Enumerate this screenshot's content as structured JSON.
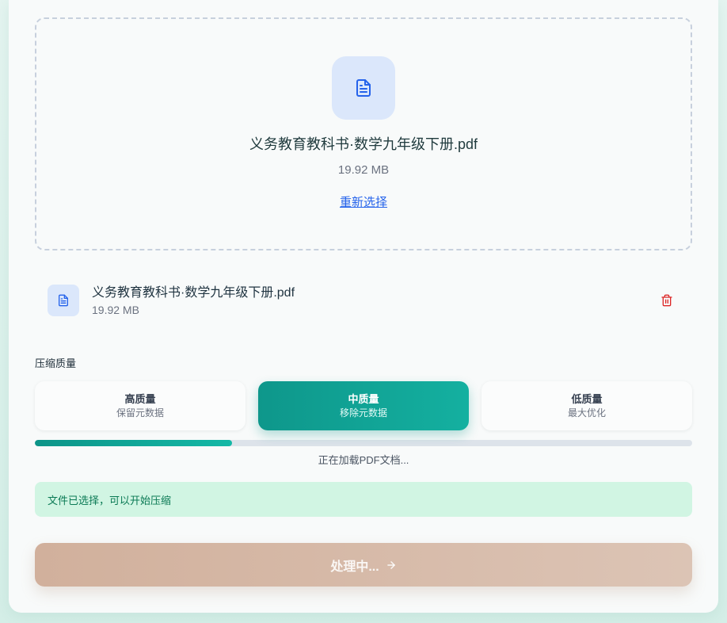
{
  "upload": {
    "icon": "file-text-icon",
    "file_name": "义务教育教科书·数学九年级下册.pdf",
    "file_size": "19.92 MB",
    "reselect_label": "重新选择"
  },
  "file_list": [
    {
      "icon": "file-text-icon",
      "name": "义务教育教科书·数学九年级下册.pdf",
      "size": "19.92 MB",
      "delete_icon": "trash-icon"
    }
  ],
  "quality": {
    "label": "压缩质量",
    "options": [
      {
        "title": "高质量",
        "desc": "保留元数据",
        "selected": false
      },
      {
        "title": "中质量",
        "desc": "移除元数据",
        "selected": true
      },
      {
        "title": "低质量",
        "desc": "最大优化",
        "selected": false
      }
    ]
  },
  "progress": {
    "percent": 30,
    "status": "正在加载PDF文档..."
  },
  "alert": {
    "type": "success",
    "text": "文件已选择，可以开始压缩"
  },
  "action": {
    "label": "处理中...",
    "icon": "arrow-right-icon",
    "disabled": true
  },
  "colors": {
    "accent": "#0d9488",
    "accent_light": "#14b8a6",
    "file_icon": "#2563eb",
    "file_icon_bg": "#dbe7fb",
    "danger": "#dc2626",
    "alert_bg": "#d1f5e3",
    "alert_text": "#0b7a55",
    "button_start": "#d1b09c",
    "button_end": "#dcc4b5"
  }
}
